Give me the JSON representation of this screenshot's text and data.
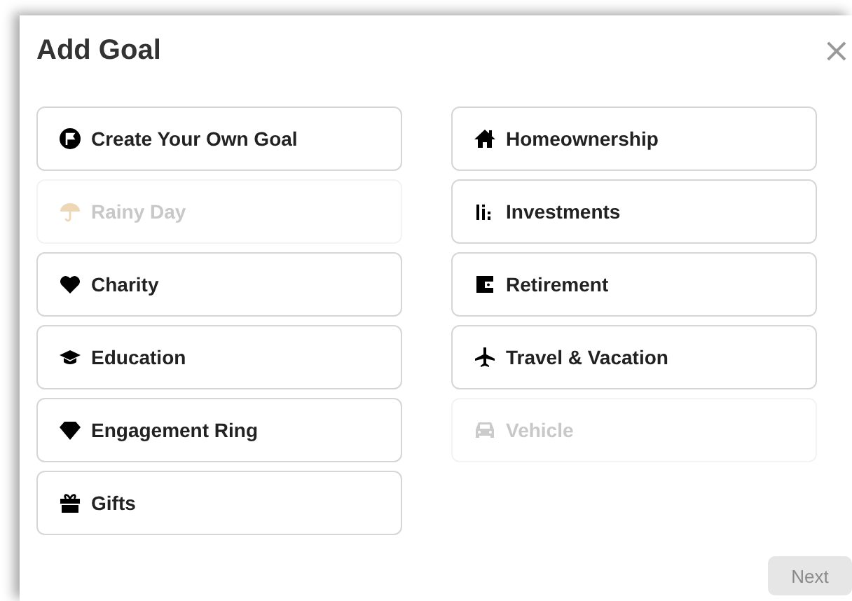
{
  "dialog": {
    "title": "Add Goal",
    "close": "×"
  },
  "left_options": [
    {
      "kind": "flag",
      "label": "Create Your Own Goal",
      "disabled": false
    },
    {
      "kind": "umbrella",
      "label": "Rainy Day",
      "disabled": true
    },
    {
      "kind": "heart",
      "label": "Charity",
      "disabled": false
    },
    {
      "kind": "cap",
      "label": "Education",
      "disabled": false
    },
    {
      "kind": "gem",
      "label": "Engagement Ring",
      "disabled": false
    },
    {
      "kind": "gift",
      "label": "Gifts",
      "disabled": false
    }
  ],
  "right_options": [
    {
      "kind": "home",
      "label": "Homeownership",
      "disabled": false
    },
    {
      "kind": "bars",
      "label": "Investments",
      "disabled": false
    },
    {
      "kind": "wallet",
      "label": "Retirement",
      "disabled": false
    },
    {
      "kind": "plane",
      "label": "Travel & Vacation",
      "disabled": false
    },
    {
      "kind": "car",
      "label": "Vehicle",
      "disabled": true
    }
  ],
  "next_button": {
    "label": "Next",
    "disabled": true
  }
}
